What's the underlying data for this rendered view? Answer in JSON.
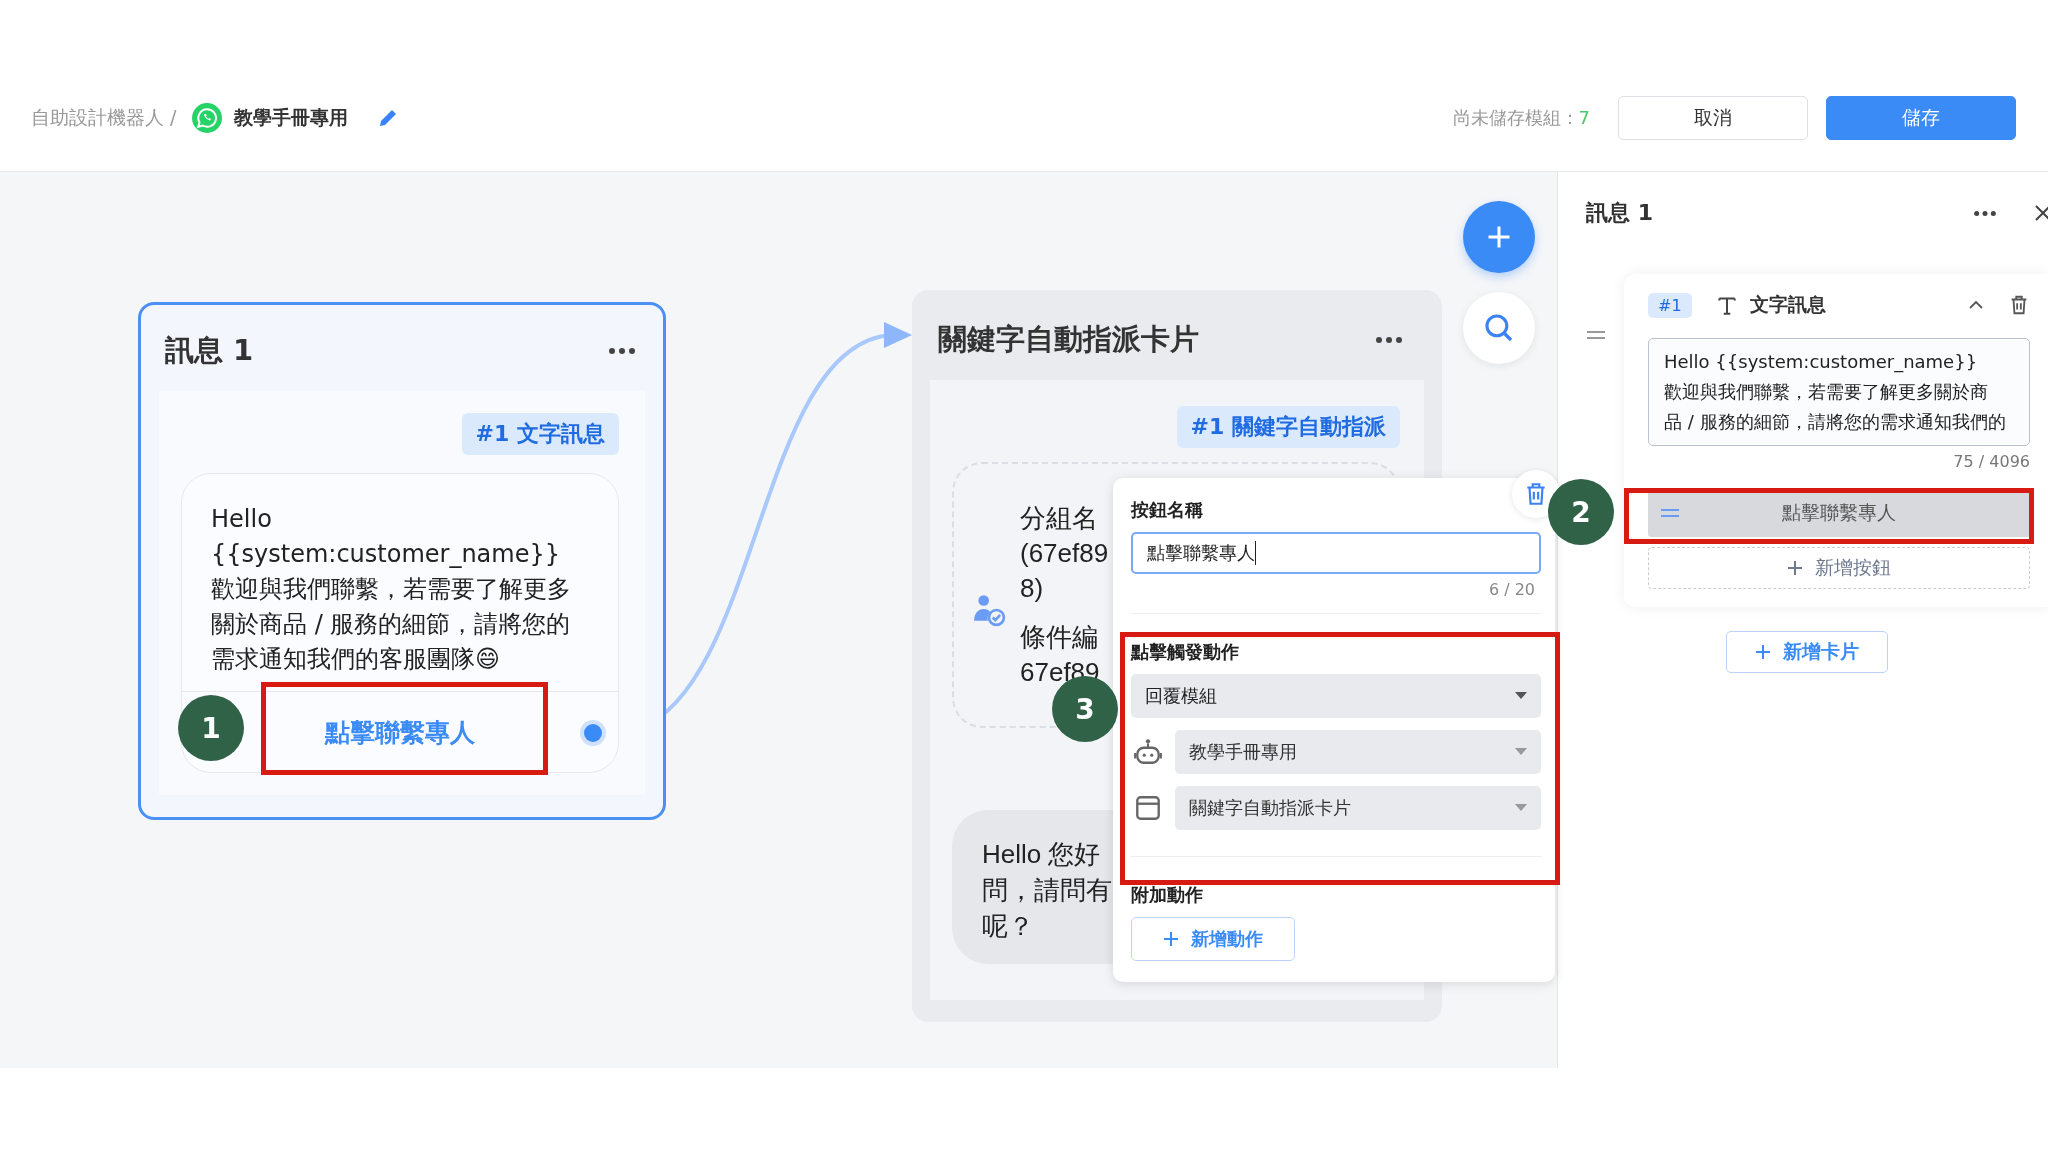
{
  "header": {
    "breadcrumb": "自助設計機器人 /",
    "bot_name": "教學手冊專用",
    "unsaved_label": "尚未儲存模組：",
    "unsaved_count": "7",
    "buttons": [
      {
        "label": "取消",
        "kind": "secondary"
      },
      {
        "label": "儲存",
        "kind": "primary"
      }
    ]
  },
  "message_node": {
    "title": "訊息 1",
    "tag": "#1 文字訊息",
    "lines": [
      "Hello",
      "{{system:customer_name}}",
      "歡迎與我們聯繫，若需要了解更多",
      "關於商品 / 服務的細節，請將您的",
      "需求通知我們的客服團隊😄"
    ],
    "button": "點擊聯繫專人"
  },
  "assign_node": {
    "title": "關鍵字自動指派卡片",
    "tag": "#1 關鍵字自動指派",
    "group_lines": [
      "分組名",
      "(67ef89",
      "8)"
    ],
    "condition_lines": [
      "條件編",
      "67ef89"
    ],
    "reply_lines": [
      "Hello 您好",
      "問，請問有",
      "呢？"
    ]
  },
  "button_editor": {
    "name_label": "按鈕名稱",
    "name_value": "點擊聯繫專人",
    "name_count": "6 / 20",
    "action_label": "點擊觸發動作",
    "selects": [
      {
        "kind": "plain",
        "value": "回覆模組"
      },
      {
        "kind": "bot",
        "value": "教學手冊專用"
      },
      {
        "kind": "card",
        "value": "關鍵字自動指派卡片"
      }
    ],
    "extra_label": "附加動作",
    "add_action": "新增動作"
  },
  "side_panel": {
    "title": "訊息 1",
    "block_number": "#1",
    "block_type": "文字訊息",
    "text_lines": [
      "Hello {{system:customer_name}}",
      "歡迎與我們聯繫，若需要了解更多關於商",
      "品 / 服務的細節，請將您的需求通知我們的"
    ],
    "text_count": "75 / 4096",
    "button_label": "點擊聯繫專人",
    "add_button": "新增按鈕",
    "add_card": "新增卡片"
  },
  "annotations": [
    {
      "label": "1"
    },
    {
      "label": "2"
    },
    {
      "label": "3"
    }
  ]
}
